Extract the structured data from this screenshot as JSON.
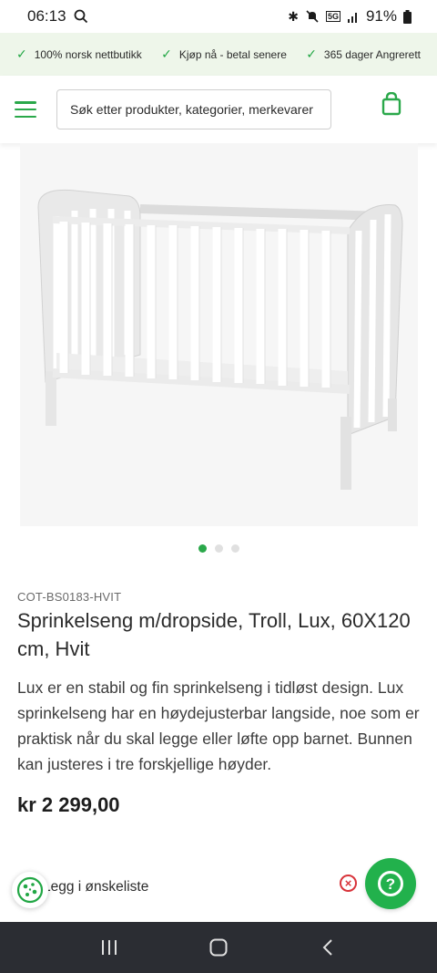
{
  "status_bar": {
    "time": "06:13",
    "network": "5G",
    "battery": "91%"
  },
  "usp": [
    {
      "label": "100% norsk nettbutikk"
    },
    {
      "label": "Kjøp nå - betal senere"
    },
    {
      "label": "365 dager Angrerett"
    }
  ],
  "header": {
    "search_placeholder": "Søk etter produkter, kategorier, merkevarer"
  },
  "carousel": {
    "total": 3,
    "active": 1
  },
  "product": {
    "sku": "COT-BS0183-HVIT",
    "title": "Sprinkelseng m/dropside, Troll, Lux, 60X120 cm, Hvit",
    "description": "Lux er en stabil og fin sprinkelseng i tidløst design. Lux sprinkelseng har en høydejusterbar langside, noe som er praktisk når du skal legge eller løfte opp barnet. Bunnen kan justeres i tre forskjellige høyder.",
    "price": "kr 2 299,00"
  },
  "actions": {
    "wishlist_label": "Legg i ønskeliste",
    "hidden_char": "t"
  },
  "colors": {
    "brand_green": "#2aa84a",
    "usp_background": "#eef6ea",
    "nav_background": "#2b2d33"
  }
}
